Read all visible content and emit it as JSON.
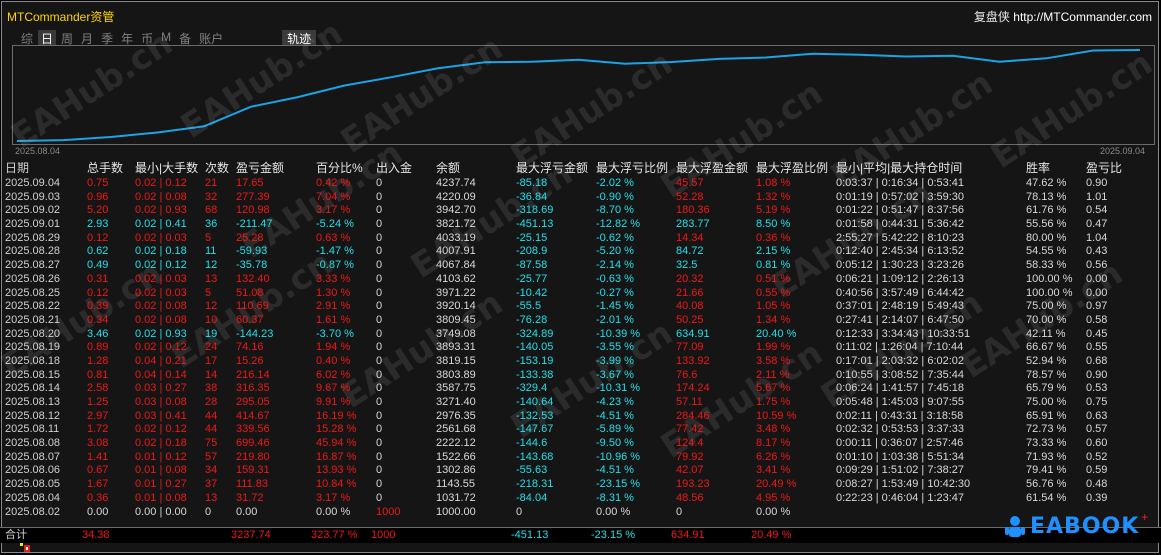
{
  "header": {
    "brand": "MTCommander资管",
    "helper_label": "复盘侠",
    "helper_url": "http://MTCommander.com"
  },
  "periods": {
    "items": [
      "综",
      "日",
      "周",
      "月",
      "季",
      "年",
      "币",
      "M",
      "备",
      "账户"
    ],
    "active": "日",
    "track": "轨迹"
  },
  "chart_data": {
    "type": "line",
    "x": [
      "2025.08.02",
      "2025.08.04",
      "2025.08.05",
      "2025.08.06",
      "2025.08.07",
      "2025.08.08",
      "2025.08.11",
      "2025.08.12",
      "2025.08.13",
      "2025.08.14",
      "2025.08.15",
      "2025.08.18",
      "2025.08.19",
      "2025.08.20",
      "2025.08.21",
      "2025.08.22",
      "2025.08.25",
      "2025.08.26",
      "2025.08.27",
      "2025.08.28",
      "2025.08.29",
      "2025.09.01",
      "2025.09.02",
      "2025.09.03",
      "2025.09.04"
    ],
    "values": [
      1000,
      1031.72,
      1143.55,
      1302.86,
      1522.66,
      2222.12,
      2561.68,
      2976.35,
      3271.4,
      3587.75,
      3803.89,
      3819.15,
      3893.31,
      3749.08,
      3809.45,
      3920.14,
      3971.22,
      4103.62,
      4067.84,
      4007.91,
      4033.19,
      3821.72,
      3942.7,
      4220.09,
      4237.74
    ],
    "xlabel_start": "2025.08.04",
    "xlabel_end": "2025.09.04",
    "color": "#1aa3e8"
  },
  "table": {
    "headers": [
      "日期",
      "总手数",
      "最小|大手数",
      "次数",
      "盈亏金额",
      "百分比%",
      "出入金",
      "余额",
      "最大浮亏金额",
      "最大浮亏比例",
      "最大浮盈金额",
      "最大浮盈比例",
      "最小|平均|最大持仓时间",
      "胜率",
      "盈亏比"
    ],
    "rows": [
      [
        "2025.09.04",
        "0.75",
        "0.02 | 0.12",
        "21",
        "17.65",
        "0.42 %",
        "0",
        "4237.74",
        "-85.18",
        "-2.02 %",
        "45.57",
        "1.08 %",
        "0:03:37 | 0:16:34 | 0:53:41",
        "47.62 %",
        "0.90"
      ],
      [
        "2025.09.03",
        "0.96",
        "0.02 | 0.08",
        "32",
        "277.39",
        "7.04 %",
        "0",
        "4220.09",
        "-36.84",
        "-0.90 %",
        "52.28",
        "1.32 %",
        "0:01:19 | 0:57:02 | 3:59:30",
        "78.13 %",
        "1.01"
      ],
      [
        "2025.09.02",
        "5.20",
        "0.02 | 0.93",
        "68",
        "120.98",
        "3.17 %",
        "0",
        "3942.70",
        "-318.69",
        "-8.70 %",
        "180.36",
        "5.19 %",
        "0:01:22 | 0:51:47 | 8:37:56",
        "61.76 %",
        "0.54"
      ],
      [
        "2025.09.01",
        "2.93",
        "0.02 | 0.41",
        "36",
        "-211.47",
        "-5.24 %",
        "0",
        "3821.72",
        "-451.13",
        "-12.82 %",
        "283.77",
        "8.50 %",
        "0:01:58 | 0:44:31 | 5:36:42",
        "55.56 %",
        "0.47"
      ],
      [
        "2025.08.29",
        "0.12",
        "0.02 | 0.03",
        "5",
        "25.28",
        "0.63 %",
        "0",
        "4033.19",
        "-25.15",
        "-0.62 %",
        "14.34",
        "0.36 %",
        "2:55:27 | 5:42:22 | 8:10:23",
        "80.00 %",
        "1.04"
      ],
      [
        "2025.08.28",
        "0.62",
        "0.02 | 0.18",
        "11",
        "-59.93",
        "-1.47 %",
        "0",
        "4007.91",
        "-208.9",
        "-5.20 %",
        "84.72",
        "2.15 %",
        "0:12:40 | 2:45:34 | 6:13:52",
        "54.55 %",
        "0.43"
      ],
      [
        "2025.08.27",
        "0.49",
        "0.02 | 0.12",
        "12",
        "-35.78",
        "-0.87 %",
        "0",
        "4067.84",
        "-87.58",
        "-2.14 %",
        "32.5",
        "0.81 %",
        "0:05:12 | 1:30:23 | 3:23:26",
        "58.33 %",
        "0.56"
      ],
      [
        "2025.08.26",
        "0.31",
        "0.02 | 0.03",
        "13",
        "132.40",
        "3.33 %",
        "0",
        "4103.62",
        "-25.77",
        "-0.63 %",
        "20.32",
        "0.51 %",
        "0:06:21 | 1:09:12 | 2:26:13",
        "100.00 %",
        "0.00"
      ],
      [
        "2025.08.25",
        "0.12",
        "0.02 | 0.03",
        "5",
        "51.08",
        "1.30 %",
        "0",
        "3971.22",
        "-10.42",
        "-0.27 %",
        "21.66",
        "0.55 %",
        "0:40:56 | 3:57:49 | 6:44:42",
        "100.00 %",
        "0.00"
      ],
      [
        "2025.08.22",
        "0.39",
        "0.02 | 0.08",
        "12",
        "110.69",
        "2.91 %",
        "0",
        "3920.14",
        "-55.5",
        "-1.45 %",
        "40.08",
        "1.05 %",
        "0:37:01 | 2:48:19 | 5:49:43",
        "75.00 %",
        "0.97"
      ],
      [
        "2025.08.21",
        "0.34",
        "0.02 | 0.08",
        "10",
        "60.37",
        "1.61 %",
        "0",
        "3809.45",
        "-76.28",
        "-2.01 %",
        "50.25",
        "1.34 %",
        "0:27:41 | 2:14:07 | 6:47:50",
        "70.00 %",
        "0.58"
      ],
      [
        "2025.08.20",
        "3.46",
        "0.02 | 0.93",
        "19",
        "-144.23",
        "-3.70 %",
        "0",
        "3749.08",
        "-324.89",
        "-10.39 %",
        "634.91",
        "20.40 %",
        "0:12:33 | 3:34:43 | 10:33:51",
        "42.11 %",
        "0.45"
      ],
      [
        "2025.08.19",
        "0.89",
        "0.02 | 0.12",
        "24",
        "74.16",
        "1.94 %",
        "0",
        "3893.31",
        "-140.05",
        "-3.55 %",
        "77.09",
        "1.99 %",
        "0:11:02 | 1:26:04 | 7:10:44",
        "66.67 %",
        "0.55"
      ],
      [
        "2025.08.18",
        "1.28",
        "0.04 | 0.21",
        "17",
        "15.26",
        "0.40 %",
        "0",
        "3819.15",
        "-153.19",
        "-3.99 %",
        "133.92",
        "3.58 %",
        "0:17:01 | 2:03:32 | 6:02:02",
        "52.94 %",
        "0.68"
      ],
      [
        "2025.08.15",
        "0.81",
        "0.04 | 0.14",
        "14",
        "216.14",
        "6.02 %",
        "0",
        "3803.89",
        "-133.38",
        "-3.67 %",
        "76.6",
        "2.11 %",
        "0:10:55 | 3:08:52 | 7:35:44",
        "78.57 %",
        "0.90"
      ],
      [
        "2025.08.14",
        "2.58",
        "0.03 | 0.27",
        "38",
        "316.35",
        "9.67 %",
        "0",
        "3587.75",
        "-329.4",
        "-10.31 %",
        "174.24",
        "5.67 %",
        "0:06:24 | 1:41:57 | 7:45:18",
        "65.79 %",
        "0.53"
      ],
      [
        "2025.08.13",
        "1.25",
        "0.03 | 0.08",
        "28",
        "295.05",
        "9.91 %",
        "0",
        "3271.40",
        "-140.64",
        "-4.23 %",
        "57.11",
        "1.75 %",
        "0:05:48 | 1:45:03 | 9:07:55",
        "75.00 %",
        "0.75"
      ],
      [
        "2025.08.12",
        "2.97",
        "0.03 | 0.41",
        "44",
        "414.67",
        "16.19 %",
        "0",
        "2976.35",
        "-132.53",
        "-4.51 %",
        "284.46",
        "10.59 %",
        "0:02:11 | 0:43:31 | 3:18:58",
        "65.91 %",
        "0.63"
      ],
      [
        "2025.08.11",
        "1.72",
        "0.02 | 0.12",
        "44",
        "339.56",
        "15.28 %",
        "0",
        "2561.68",
        "-147.67",
        "-5.89 %",
        "77.42",
        "3.48 %",
        "0:02:32 | 0:53:53 | 3:37:33",
        "72.73 %",
        "0.57"
      ],
      [
        "2025.08.08",
        "3.08",
        "0.02 | 0.18",
        "75",
        "699.46",
        "45.94 %",
        "0",
        "2222.12",
        "-144.6",
        "-9.50 %",
        "124.4",
        "8.17 %",
        "0:00:11 | 0:36:07 | 2:57:46",
        "73.33 %",
        "0.60"
      ],
      [
        "2025.08.07",
        "1.41",
        "0.01 | 0.12",
        "57",
        "219.80",
        "16.87 %",
        "0",
        "1522.66",
        "-143.68",
        "-10.96 %",
        "79.92",
        "6.26 %",
        "0:01:10 | 1:03:38 | 5:51:34",
        "71.93 %",
        "0.52"
      ],
      [
        "2025.08.06",
        "0.67",
        "0.01 | 0.08",
        "34",
        "159.31",
        "13.93 %",
        "0",
        "1302.86",
        "-55.63",
        "-4.51 %",
        "42.07",
        "3.41 %",
        "0:09:29 | 1:51:02 | 7:38:27",
        "79.41 %",
        "0.59"
      ],
      [
        "2025.08.05",
        "1.67",
        "0.01 | 0.27",
        "37",
        "111.83",
        "10.84 %",
        "0",
        "1143.55",
        "-218.31",
        "-23.15 %",
        "193.23",
        "20.49 %",
        "0:08:27 | 1:53:49 | 10:42:30",
        "56.76 %",
        "0.48"
      ],
      [
        "2025.08.04",
        "0.36",
        "0.01 | 0.08",
        "13",
        "31.72",
        "3.17 %",
        "0",
        "1031.72",
        "-84.04",
        "-8.31 %",
        "48.56",
        "4.95 %",
        "0:22:23 | 0:46:04 | 1:23:47",
        "61.54 %",
        "0.39"
      ],
      [
        "2025.08.02",
        "0.00",
        "0.00 | 0.00",
        "0",
        "0.00",
        "0.00 %",
        "1000",
        "1000.00",
        "0",
        "0.00 %",
        "0",
        "0.00 %",
        "",
        "",
        ""
      ]
    ],
    "total": [
      "合计",
      "34.38",
      "",
      "",
      "3237.74",
      "323.77 %",
      "1000",
      "",
      "-451.13",
      "-23.15 %",
      "634.91",
      "20.49 %",
      "",
      "",
      ""
    ]
  },
  "logo": {
    "text": "EABOOK",
    "plus": "+"
  },
  "watermark": "EAHub.cn"
}
